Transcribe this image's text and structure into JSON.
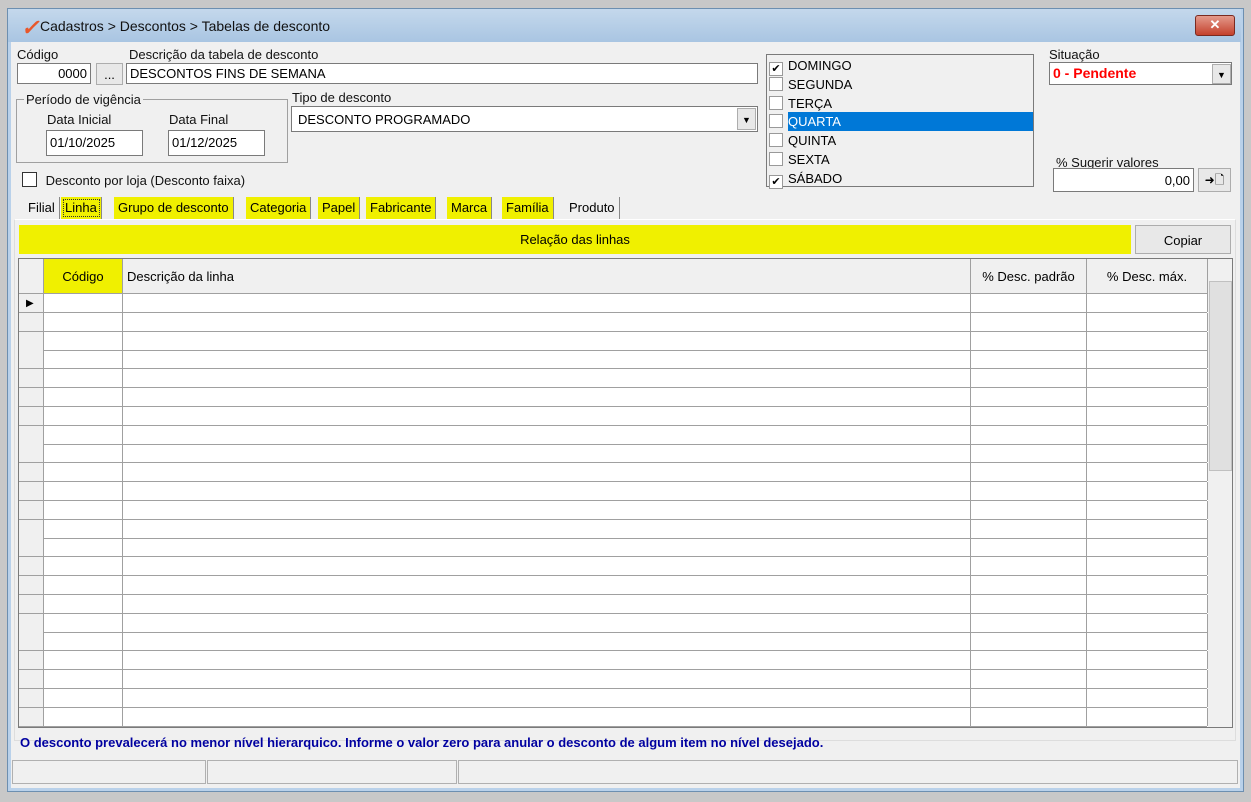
{
  "window": {
    "title": "Cadastros > Descontos > Tabelas de desconto",
    "close": "✕"
  },
  "form": {
    "codigo_label": "Código",
    "codigo_value": "0000",
    "lookup_button": "...",
    "descricao_label": "Descrição da tabela de desconto",
    "descricao_value": "DESCONTOS FINS DE SEMANA",
    "periodo_label": "Período de vigência",
    "data_inicial_label": "Data Inicial",
    "data_inicial_value": "01/10/2025",
    "data_final_label": "Data Final",
    "data_final_value": "01/12/2025",
    "tipo_label": "Tipo de desconto",
    "tipo_value": "DESCONTO PROGRAMADO",
    "desconto_loja_label": "Desconto por loja (Desconto faixa)",
    "situacao_label": "Situação",
    "situacao_value": "0 - Pendente",
    "sugerir_label": "% Sugerir valores",
    "sugerir_value": "0,00",
    "apply_button": "➜🗋"
  },
  "days": [
    {
      "label": "DOMINGO",
      "checked": true
    },
    {
      "label": "SEGUNDA",
      "checked": false
    },
    {
      "label": "TERÇA",
      "checked": false
    },
    {
      "label": "QUARTA",
      "checked": false,
      "selected": true
    },
    {
      "label": "QUINTA",
      "checked": false
    },
    {
      "label": "SEXTA",
      "checked": false
    },
    {
      "label": "SÁBADO",
      "checked": true
    }
  ],
  "tabs": [
    "Filial",
    "Linha",
    "Grupo de desconto",
    "Categoria",
    "Papel",
    "Fabricante",
    "Marca",
    "Família",
    "Produto"
  ],
  "panel": {
    "title": "Relação das linhas",
    "copy_button": "Copiar"
  },
  "grid": {
    "columns": [
      "Código",
      "Descrição da linha",
      "% Desc. padrão",
      "% Desc. máx."
    ]
  },
  "footer_note": "O desconto prevalecerá no menor nível hierarquico. Informe o valor zero para anular o desconto de algum item no nível desejado.",
  "colors": {
    "highlight": "#f0f000",
    "selection": "#0078d7",
    "status_red": "#ff0000",
    "note_blue": "#0000a0"
  }
}
